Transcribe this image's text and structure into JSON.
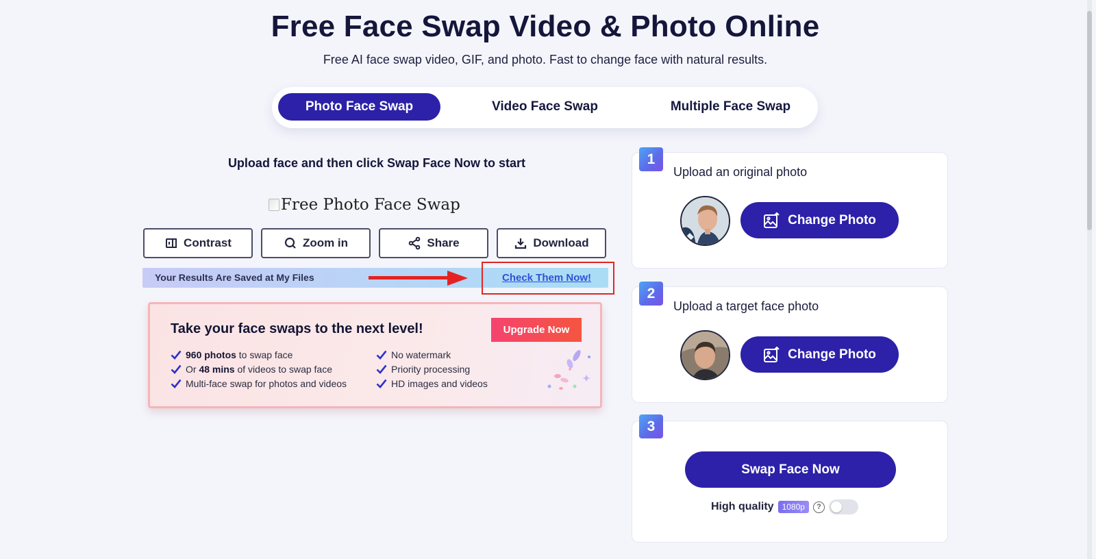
{
  "header": {
    "title": "Free Face Swap Video & Photo Online",
    "subtitle": "Free AI face swap video, GIF, and photo. Fast to change face with natural results."
  },
  "tabs": [
    {
      "label": "Photo Face Swap",
      "active": true
    },
    {
      "label": "Video Face Swap",
      "active": false
    },
    {
      "label": "Multiple Face Swap",
      "active": false
    }
  ],
  "left": {
    "instruction": "Upload face and then click Swap Face Now to start",
    "image_alt": "Free Photo Face Swap",
    "tools": {
      "contrast": "Contrast",
      "zoom": "Zoom in",
      "share": "Share",
      "download": "Download"
    },
    "saved_bar": {
      "text": "Your Results Are Saved at My Files",
      "link": "Check Them Now!"
    },
    "promo": {
      "title": "Take your face swaps to the next level!",
      "button": "Upgrade Now",
      "features_left": [
        {
          "bold": "960 photos",
          "text": " to swap face",
          "prefix": ""
        },
        {
          "prefix": "Or ",
          "bold": "48 mins",
          "text": " of videos to swap face"
        },
        {
          "prefix": "",
          "bold": "",
          "text": "Multi-face swap for photos and videos"
        }
      ],
      "features_right": [
        "No watermark",
        "Priority processing",
        "HD images and videos"
      ]
    }
  },
  "steps": {
    "step1": {
      "number": "1",
      "label": "Upload an original photo",
      "button": "Change Photo"
    },
    "step2": {
      "number": "2",
      "label": "Upload a target face photo",
      "button": "Change Photo"
    },
    "step3": {
      "number": "3",
      "button": "Swap Face Now",
      "quality_label": "High quality",
      "quality_badge": "1080p",
      "help": "?",
      "toggle_on": false
    }
  },
  "colors": {
    "primary": "#2c21a8",
    "background": "#f4f5fb",
    "link": "#2e52d6",
    "highlight": "#e02525",
    "upgrade": "#f5436f"
  }
}
